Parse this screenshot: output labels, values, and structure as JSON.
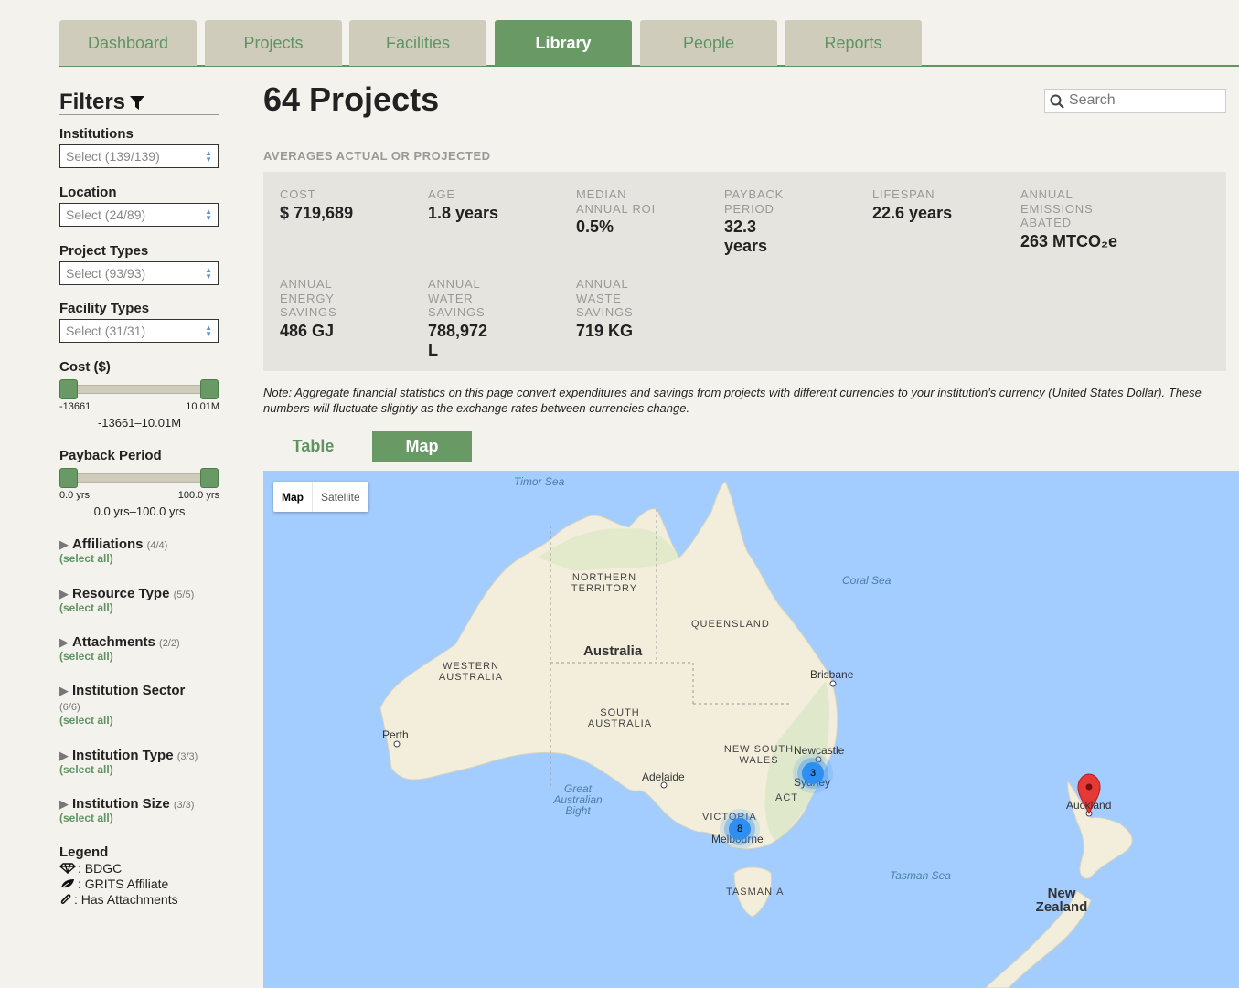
{
  "nav": {
    "tabs": [
      "Dashboard",
      "Projects",
      "Facilities",
      "Library",
      "People",
      "Reports"
    ],
    "active": "Library"
  },
  "sidebar": {
    "title": "Filters",
    "selects": [
      {
        "label": "Institutions",
        "value": "Select (139/139)"
      },
      {
        "label": "Location",
        "value": "Select (24/89)"
      },
      {
        "label": "Project Types",
        "value": "Select (93/93)"
      },
      {
        "label": "Facility Types",
        "value": "Select (31/31)"
      }
    ],
    "cost": {
      "label": "Cost ($)",
      "min": "-13661",
      "max": "10.01M",
      "range": "-13661–10.01M"
    },
    "payback": {
      "label": "Payback Period",
      "min": "0.0 yrs",
      "max": "100.0 yrs",
      "range": "0.0 yrs–100.0 yrs"
    },
    "groups": [
      {
        "label": "Affiliations",
        "count": "(4/4)",
        "select_all": "(select all)"
      },
      {
        "label": "Resource Type",
        "count": "(5/5)",
        "select_all": "(select all)"
      },
      {
        "label": "Attachments",
        "count": "(2/2)",
        "select_all": "(select all)"
      },
      {
        "label": "Institution Sector",
        "count": "(6/6)",
        "select_all": "(select all)"
      },
      {
        "label": "Institution Type",
        "count": "(3/3)",
        "select_all": "(select all)"
      },
      {
        "label": "Institution Size",
        "count": "(3/3)",
        "select_all": "(select all)"
      }
    ],
    "legend": {
      "title": "Legend",
      "items": [
        {
          "icon": "diamond-icon",
          "label": ": BDGC"
        },
        {
          "icon": "leaf-icon",
          "label": ": GRITS Affiliate"
        },
        {
          "icon": "paperclip-icon",
          "label": ": Has Attachments"
        }
      ]
    }
  },
  "main": {
    "title": "64 Projects",
    "search_placeholder": "Search",
    "averages_heading": "AVERAGES ACTUAL OR PROJECTED",
    "stats": [
      {
        "label": "COST",
        "value": "$ 719,689"
      },
      {
        "label": "AGE",
        "value": "1.8 years"
      },
      {
        "label": "MEDIAN ANNUAL ROI",
        "value": "0.5%"
      },
      {
        "label": "PAYBACK PERIOD",
        "value": "32.3 years"
      },
      {
        "label": "LIFESPAN",
        "value": "22.6 years"
      },
      {
        "label": "ANNUAL EMISSIONS ABATED",
        "value": "263 MTCO₂e"
      },
      {
        "label": "ANNUAL ENERGY SAVINGS",
        "value": "486 GJ"
      },
      {
        "label": "ANNUAL WATER SAVINGS",
        "value": "788,972 L"
      },
      {
        "label": "ANNUAL WASTE SAVINGS",
        "value": "719 KG"
      }
    ],
    "note": "Note: Aggregate financial statistics on this page convert expenditures and savings from projects with different currencies to your institution's currency (United States Dollar). These numbers will fluctuate slightly as the exchange rates between currencies change.",
    "view_tabs": [
      "Table",
      "Map"
    ],
    "active_view": "Map"
  },
  "map": {
    "type_buttons": [
      "Map",
      "Satellite"
    ],
    "seas": [
      "Timor Sea",
      "Coral Sea",
      "Great Australian Bight",
      "Tasman Sea"
    ],
    "regions": [
      "NORTHERN TERRITORY",
      "QUEENSLAND",
      "WESTERN AUSTRALIA",
      "SOUTH AUSTRALIA",
      "NEW SOUTH WALES",
      "VICTORIA",
      "TASMANIA",
      "ACT"
    ],
    "countries": [
      "Australia",
      "New Zealand"
    ],
    "cities": [
      "Brisbane",
      "Perth",
      "Adelaide",
      "Newcastle",
      "Sydney",
      "Melbourne",
      "Auckland"
    ],
    "clusters": [
      {
        "city": "Sydney",
        "count": "3"
      },
      {
        "city": "Melbourne",
        "count": "8"
      }
    ],
    "colors": {
      "water": "#a3ccff",
      "land": "#f2eedb",
      "accent": "#699a66"
    }
  }
}
